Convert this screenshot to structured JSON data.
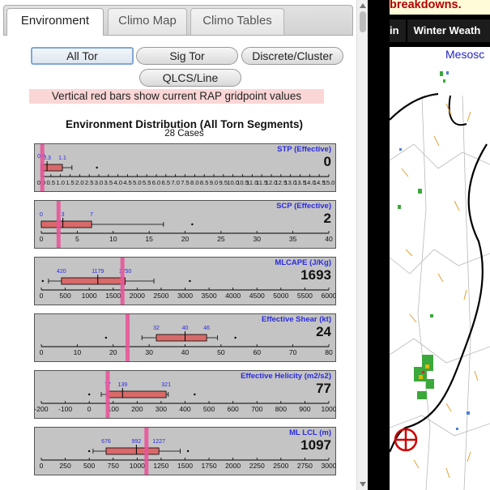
{
  "tabs": [
    {
      "label": "Environment",
      "active": true
    },
    {
      "label": "Climo Map",
      "active": false
    },
    {
      "label": "Climo Tables",
      "active": false
    }
  ],
  "filters": [
    {
      "label": "All Tor",
      "selected": true
    },
    {
      "label": "Sig Tor",
      "selected": false
    },
    {
      "label": "Discrete/Cluster",
      "selected": false
    },
    {
      "label": "QLCS/Line",
      "selected": false
    }
  ],
  "note": "Vertical red bars show current RAP gridpoint values",
  "distribution": {
    "title": "Environment Distribution (All Torn Segments)",
    "subtitle": "28 Cases"
  },
  "colors": {
    "box": "#d96a6a",
    "current_bar": "#e8559a",
    "label_blue": "#2a2ae0",
    "panel_bg": "#c4c4c4"
  },
  "chart_data": [
    {
      "type": "box",
      "title": "STP (Effective)",
      "current_value_label": "0",
      "current": 0.05,
      "xlim": [
        0,
        15
      ],
      "ticks": [
        "0.0",
        "0.5",
        "1.0",
        "1.5",
        "2.0",
        "2.5",
        "3.0",
        "3.5",
        "4.0",
        "4.5",
        "5.0",
        "5.5",
        "6.0",
        "6.5",
        "7.0",
        "7.5",
        "8.0",
        "8.5",
        "9.0",
        "9.5",
        "10.0",
        "10.5",
        "11.0",
        "11.5",
        "12.0",
        "12.5",
        "13.0",
        "13.5",
        "14.0",
        "14.5",
        "15.0"
      ],
      "box": {
        "whisker_low": 0.0,
        "q1": 0.0,
        "median": 0.3,
        "q3": 1.1,
        "whisker_high": 1.6
      },
      "labels": [
        "0.0",
        "0.3",
        "1.1"
      ],
      "outliers": [
        2.9
      ]
    },
    {
      "type": "box",
      "title": "SCP (Effective)",
      "current_value_label": "2",
      "current": 2.4,
      "xlim": [
        0,
        40
      ],
      "ticks": [
        "0",
        "5",
        "10",
        "15",
        "20",
        "25",
        "30",
        "35",
        "40"
      ],
      "box": {
        "whisker_low": 0.0,
        "q1": 0.0,
        "median": 3,
        "q3": 7,
        "whisker_high": 17
      },
      "labels": [
        "0",
        "3",
        "7"
      ],
      "outliers": [
        21
      ]
    },
    {
      "type": "box",
      "title": "MLCAPE (J/Kg)",
      "current_value_label": "1693",
      "current": 1693,
      "xlim": [
        0,
        6000
      ],
      "ticks": [
        "0",
        "500",
        "1000",
        "1500",
        "2000",
        "2500",
        "3000",
        "3500",
        "4000",
        "4500",
        "5000",
        "5500",
        "6000"
      ],
      "box": {
        "whisker_low": 150,
        "q1": 420,
        "median": 1179,
        "q3": 1750,
        "whisker_high": 2350
      },
      "labels": [
        "420",
        "1179",
        "1750"
      ],
      "outliers": [
        30,
        3100
      ]
    },
    {
      "type": "box",
      "title": "Effective Shear (kt)",
      "current_value_label": "24",
      "current": 24,
      "xlim": [
        0,
        80
      ],
      "ticks": [
        "0",
        "10",
        "20",
        "30",
        "40",
        "50",
        "60",
        "70",
        "80"
      ],
      "box": {
        "whisker_low": 28,
        "q1": 32,
        "median": 40,
        "q3": 46,
        "whisker_high": 49
      },
      "labels": [
        "32",
        "40",
        "46"
      ],
      "outliers": [
        18,
        54
      ]
    },
    {
      "type": "box",
      "title": "Effective Helicity (m2/s2)",
      "current_value_label": "77",
      "current": 77,
      "xlim": [
        -200,
        1000
      ],
      "ticks": [
        "-200",
        "-100",
        "0",
        "100",
        "200",
        "300",
        "400",
        "500",
        "600",
        "700",
        "800",
        "900",
        "1000"
      ],
      "box": {
        "whisker_low": 50,
        "q1": 77,
        "median": 139,
        "q3": 321,
        "whisker_high": 330
      },
      "labels": [
        "77",
        "139",
        "321"
      ],
      "outliers": [
        0,
        440
      ]
    },
    {
      "type": "box",
      "title": "ML LCL (m)",
      "current_value_label": "1097",
      "current": 1097,
      "xlim": [
        0,
        3000
      ],
      "ticks": [
        "0",
        "250",
        "500",
        "750",
        "1000",
        "1250",
        "1500",
        "1750",
        "2000",
        "2250",
        "2500",
        "2750",
        "3000"
      ],
      "box": {
        "whisker_low": 540,
        "q1": 676,
        "median": 992,
        "q3": 1227,
        "whisker_high": 1450
      },
      "labels": [
        "676",
        "992",
        "1227"
      ],
      "outliers": [
        500,
        1530
      ]
    }
  ],
  "map": {
    "banner": "breakdowns.",
    "nav": [
      "in",
      "Winter Weath"
    ],
    "title": "Mesosc"
  }
}
